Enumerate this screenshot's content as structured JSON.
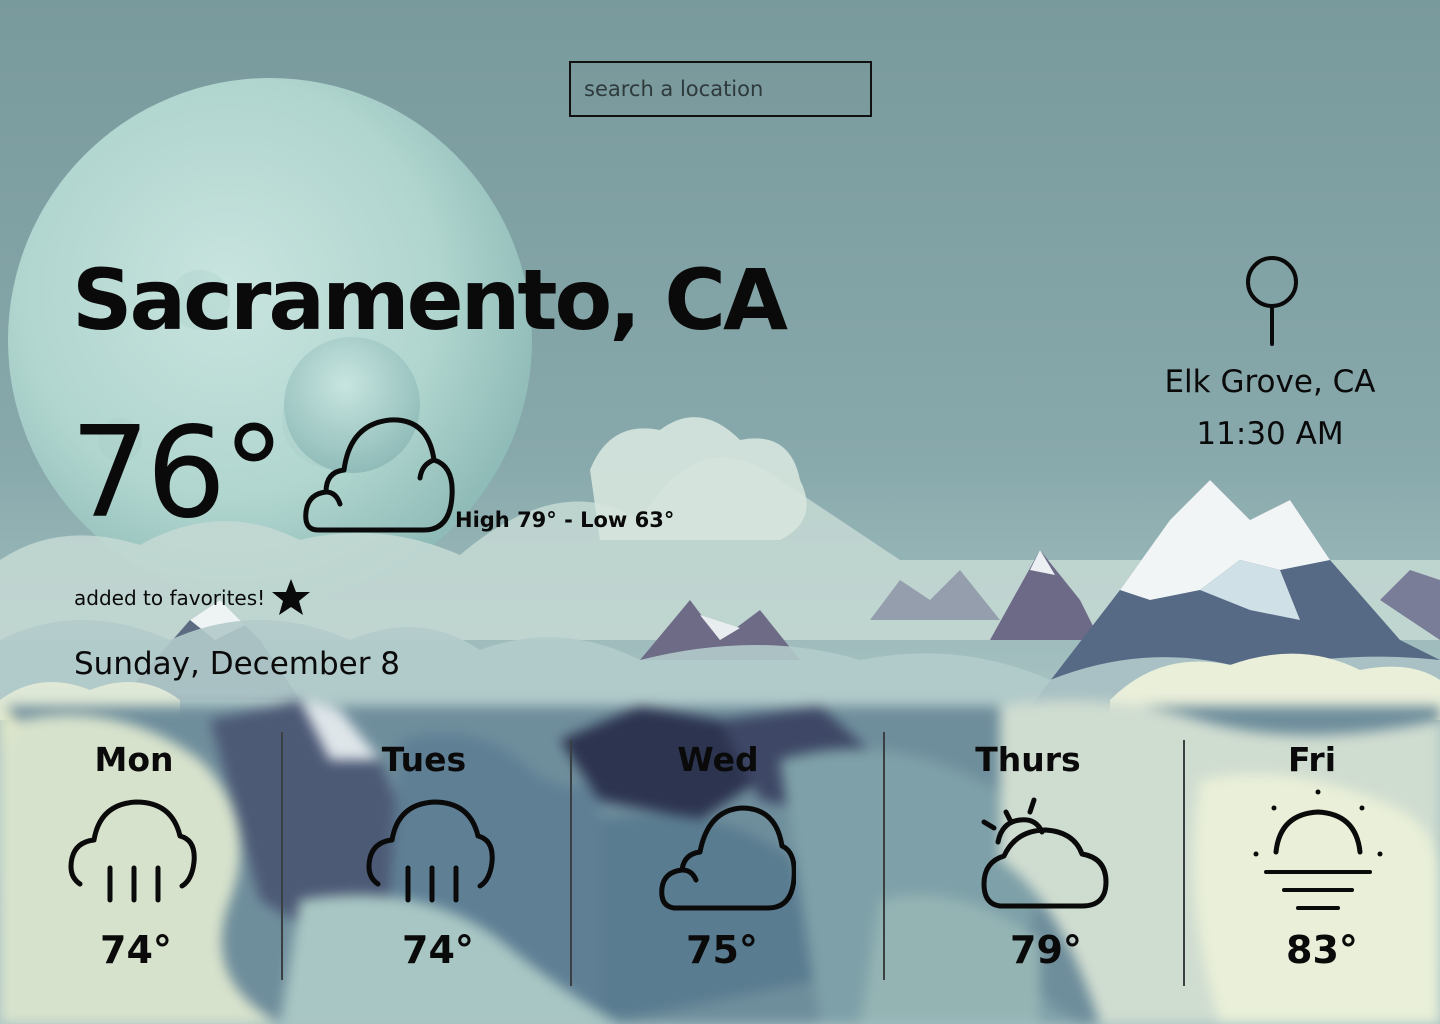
{
  "search": {
    "placeholder": "search a location",
    "value": ""
  },
  "current": {
    "city": "Sacramento, CA",
    "temperature": "76°",
    "condition_icon": "cloud-icon",
    "high_low": "High 79° - Low 63°",
    "favorite_text": "added to favorites!",
    "favorite_icon": "star-icon",
    "date": "Sunday, December 8"
  },
  "device_location": {
    "icon": "map-pin-icon",
    "name": "Elk Grove, CA",
    "time": "11:30 AM"
  },
  "forecast": [
    {
      "day": "Mon",
      "temp": "74°",
      "icon": "rain-cloud-icon"
    },
    {
      "day": "Tues",
      "temp": "74°",
      "icon": "rain-cloud-icon"
    },
    {
      "day": "Wed",
      "temp": "75°",
      "icon": "cloud-icon"
    },
    {
      "day": "Thurs",
      "temp": "79°",
      "icon": "partly-sunny-icon"
    },
    {
      "day": "Fri",
      "temp": "83°",
      "icon": "sunrise-icon"
    }
  ],
  "colors": {
    "sky": "#7e9ea1",
    "text": "#0a0a0a",
    "cloud_light": "#e6eedd",
    "snow": "#f2f6f4",
    "rock": "#6c6a84"
  }
}
